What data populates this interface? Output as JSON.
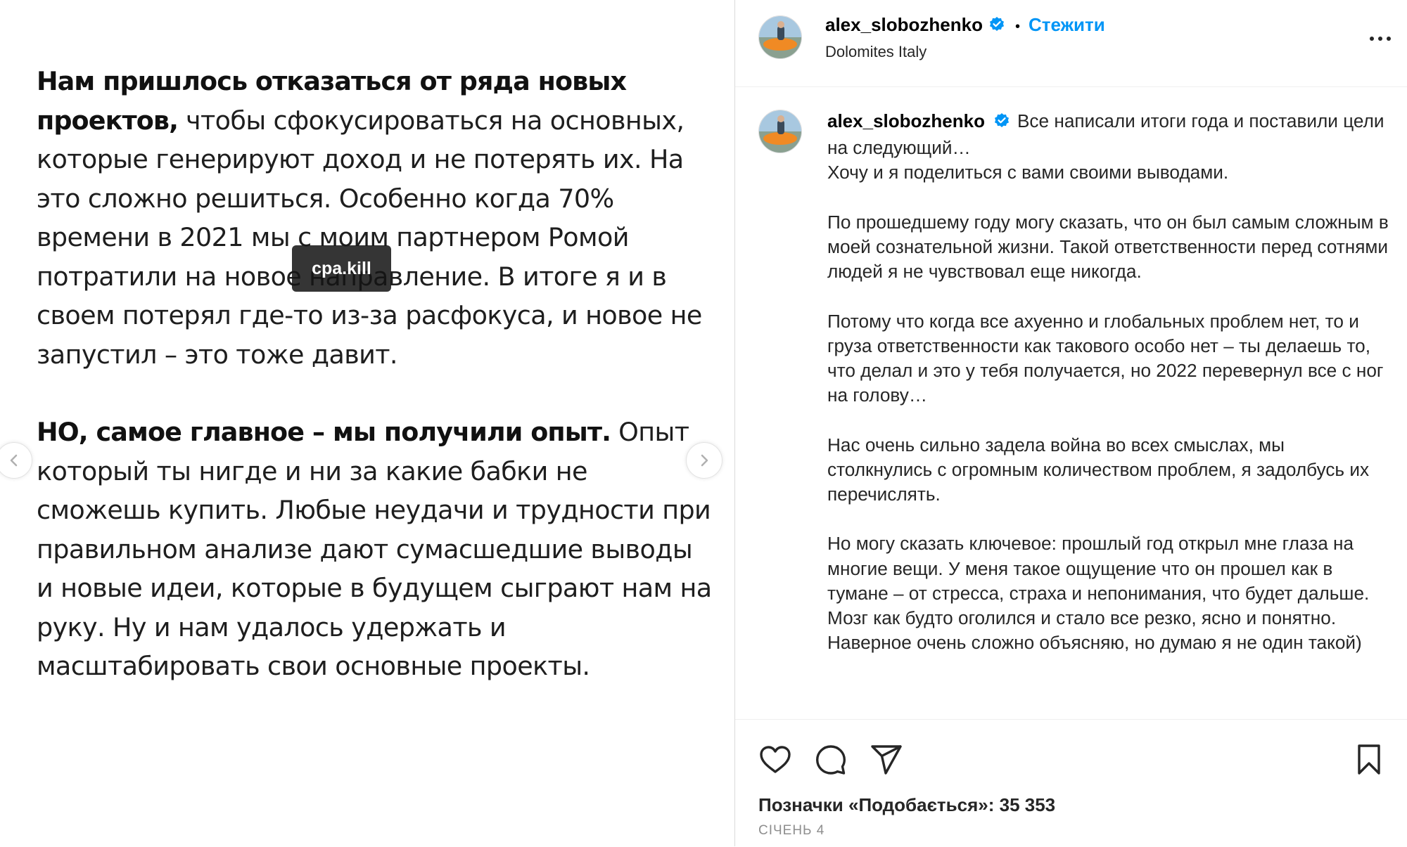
{
  "slide": {
    "para1_bold": "Нам пришлось отказаться от ряда новых проектов,",
    "para1_rest": " чтобы сфокусироваться на основных, которые генерируют доход и не потерять их. На это сложно решиться. Особенно когда 70% времени в 2021 мы с моим партнером Ромой потратили на новое направление. В итоге я и в своем потерял где-то из-за расфокуса, и новое не запустил – это тоже давит.",
    "para2_bold": "НО, самое главное – мы получили опыт.",
    "para2_rest": " Опыт который ты нигде и ни за какие бабки не сможешь купить. Любые неудачи и трудности при правильном анализе дают сумасшедшие выводы и новые идеи, которые в будущем сыграют нам на руку. Ну и нам удалось удержать и масштабировать свои основные проекты.",
    "watermark": "cpa.kill"
  },
  "post": {
    "username": "alex_slobozhenko",
    "follow_label": "Стежити",
    "location": "Dolomites Italy",
    "caption_first": "Все написали итоги года и поставили цели на следующий…",
    "caption_line2": "Хочу и я поделиться с вами своими выводами.",
    "caption_p2": "По прошедшему году могу сказать, что он был самым сложным в моей сознательной жизни. Такой ответственности перед сотнями людей я не чувствовал еще никогда.",
    "caption_p3": "Потому что когда все ахуенно и глобальных проблем нет, то и груза ответственности как такового особо нет – ты делаешь то, что делал и это у тебя получается, но 2022 перевернул все с ног на голову…",
    "caption_p4": "Нас очень сильно задела война во всех смыслах, мы столкнулись с огромным количеством проблем, я задолбусь их перечислять.",
    "caption_p5": "Но могу сказать ключевое: прошлый год открыл мне глаза на многие вещи. У меня такое ощущение что он прошел как в тумане – от стресса, страха и непонимания, что будет дальше. Мозг как будто оголился и стало все резко, ясно и понятно. Наверное очень сложно объясняю, но думаю я не один такой)",
    "likes": "Позначки «Подобається»: 35 353",
    "date": "СІЧЕНЬ 4"
  },
  "colors": {
    "accent": "#0095f6",
    "verified": "#0095f6",
    "text": "#262626",
    "muted": "#8e8e8e",
    "divider": "#dbdbdb"
  },
  "icons": [
    "chevron-left-icon",
    "chevron-right-icon",
    "verified-icon",
    "more-icon",
    "heart-icon",
    "comment-icon",
    "share-icon",
    "bookmark-icon"
  ]
}
